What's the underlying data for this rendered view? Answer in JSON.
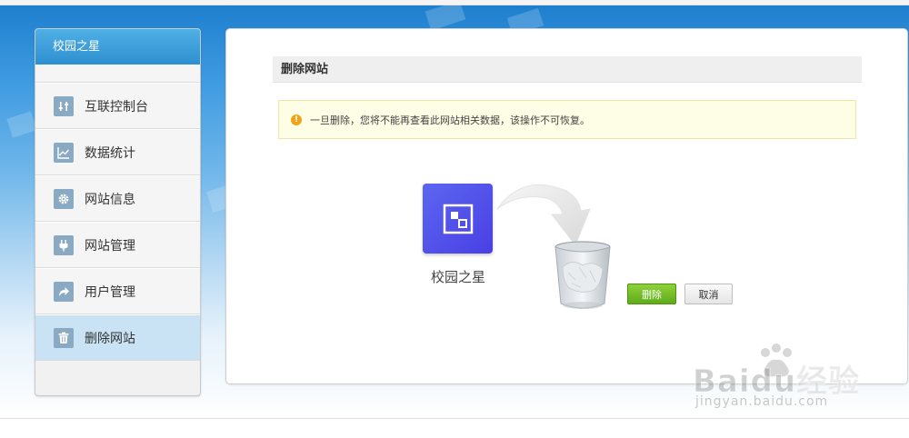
{
  "sidebar": {
    "title": "校园之星",
    "items": [
      {
        "label": "互联控制台",
        "icon": "sliders-icon"
      },
      {
        "label": "数据统计",
        "icon": "line-chart-icon"
      },
      {
        "label": "网站信息",
        "icon": "gear-icon"
      },
      {
        "label": "网站管理",
        "icon": "plug-icon"
      },
      {
        "label": "用户管理",
        "icon": "share-arrow-icon"
      },
      {
        "label": "删除网站",
        "icon": "trash-icon"
      }
    ],
    "active_index": 5
  },
  "main": {
    "section_title": "删除网站",
    "warning_text": "一旦删除，您将不能再查看此网站相关数据，该操作不可恢复。",
    "site_name": "校园之星",
    "delete_label": "删除",
    "cancel_label": "取消"
  },
  "watermark": {
    "brand": "Baidu经验",
    "url": "jingyan.baidu.com"
  },
  "colors": {
    "accent": "#2e8fd0",
    "delete_green": "#6cbf22",
    "tile_purple": "#4f4ae8",
    "active_item": "#c9e3f5"
  }
}
